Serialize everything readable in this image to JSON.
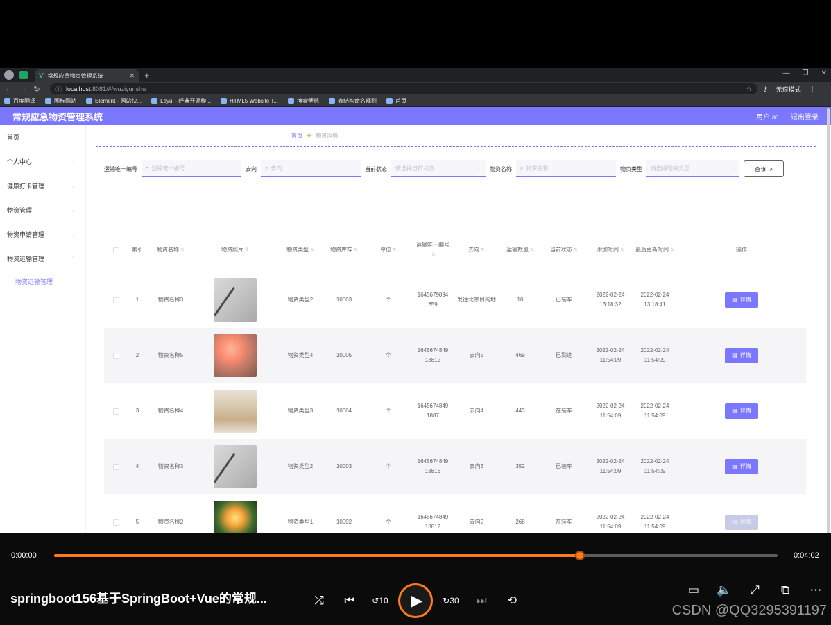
{
  "browser": {
    "tab_title": "常规应急物资管理系统",
    "url_host": "localhost",
    "url_path": ":8081/#/wuziyunshu",
    "profile": "无痕模式",
    "bookmarks": [
      "百度翻译",
      "图标网站",
      "Element - 网站快...",
      "Layui - 经典开源模...",
      "HTML5 Website T...",
      "搜索壁纸",
      "表结构命名规则",
      "首页"
    ]
  },
  "app": {
    "title": "常规应急物资管理系统",
    "user": "用户 a1",
    "logout": "退出登录",
    "accent": "#7b78ff"
  },
  "sidebar": {
    "items": [
      "首页",
      "个人中心",
      "健康打卡管理",
      "物资管理",
      "物资申请管理",
      "物资运输管理"
    ],
    "sub_item": "物资运输管理"
  },
  "breadcrumb": {
    "home": "首页",
    "current": "物资运输"
  },
  "filters": {
    "code_label": "运输唯一编号",
    "code_placeholder": "运输唯一编号",
    "dest_label": "去向",
    "dest_placeholder": "去向",
    "state_label": "当前状态",
    "state_placeholder": "请选择当前状态",
    "name_label": "物资名称",
    "name_placeholder": "物资名称",
    "type_label": "物资类型",
    "type_placeholder": "请选择物资类型",
    "query": "查询"
  },
  "table": {
    "headers": {
      "idx": "索引",
      "name": "物资名称",
      "img": "物资照片",
      "type": "物资类型",
      "stock": "物资库存",
      "unit": "单位",
      "code": "运输唯一编号",
      "dest": "去向",
      "qty": "运输数量",
      "state": "当前状态",
      "added": "添加时间",
      "updated": "最后更新时间",
      "ops": "操作"
    },
    "detail_label": "详情",
    "rows": [
      {
        "idx": "1",
        "name": "物资名称3",
        "img": "gray",
        "type": "物资类型2",
        "stock": "10003",
        "unit": "个",
        "code": "1645679894659",
        "dest": "发往北京目的地",
        "qty": "10",
        "state": "已装车",
        "added": "2022-02-24 13:18:32",
        "updated": "2022-02-24 13:18:41"
      },
      {
        "idx": "2",
        "name": "物资名称5",
        "img": "pink",
        "type": "物资类型4",
        "stock": "10005",
        "unit": "个",
        "code": "164567484918812",
        "dest": "去向5",
        "qty": "469",
        "state": "已到达",
        "added": "2022-02-24 11:54:09",
        "updated": "2022-02-24 11:54:09"
      },
      {
        "idx": "3",
        "name": "物资名称4",
        "img": "tan",
        "type": "物资类型3",
        "stock": "10004",
        "unit": "个",
        "code": "16456748491887",
        "dest": "去向4",
        "qty": "443",
        "state": "在装车",
        "added": "2022-02-24 11:54:09",
        "updated": "2022-02-24 11:54:09"
      },
      {
        "idx": "4",
        "name": "物资名称3",
        "img": "gray",
        "type": "物资类型2",
        "stock": "10003",
        "unit": "个",
        "code": "164567484918816",
        "dest": "去向3",
        "qty": "352",
        "state": "已装车",
        "added": "2022-02-24 11:54:09",
        "updated": "2022-02-24 11:54:09"
      },
      {
        "idx": "5",
        "name": "物资名称2",
        "img": "bouquet",
        "type": "物资类型1",
        "stock": "10002",
        "unit": "个",
        "code": "164567484918812",
        "dest": "去向2",
        "qty": "268",
        "state": "在装车",
        "added": "2022-02-24 11:54:09",
        "updated": "2022-02-24 11:54:09"
      }
    ]
  },
  "player": {
    "current_time": "0:00:00",
    "total_time": "0:04:02",
    "progress": 0.727,
    "title": "springboot156基于SpringBoot+Vue的常规...",
    "watermark": "CSDN @QQ3295391197",
    "rewind_label": "10",
    "forward_label": "30",
    "progress_color": "#ff7a1a"
  }
}
